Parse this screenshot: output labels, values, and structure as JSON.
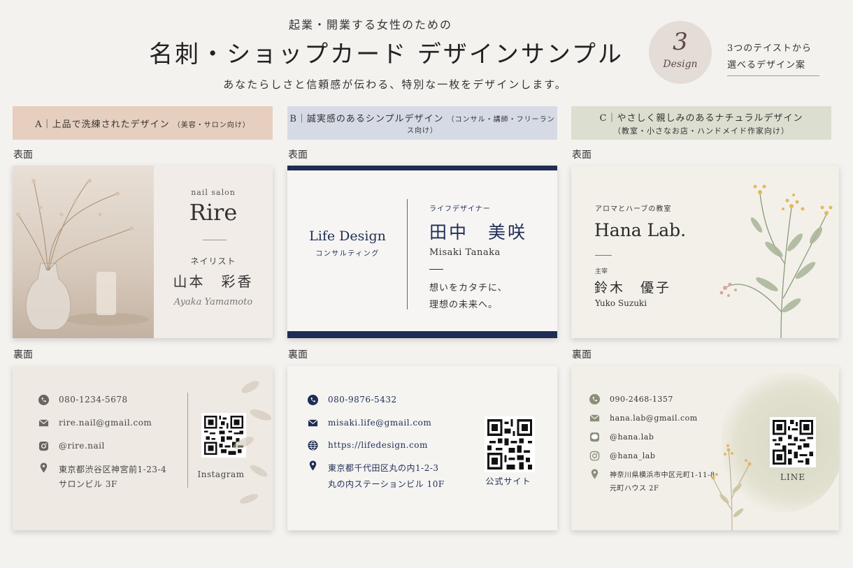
{
  "header": {
    "subtitle": "起業・開業する女性のための",
    "title": "名刺・ショップカード デザインサンプル",
    "tagline": "あなたらしさと信頼感が伝わる、特別な一枚をデザインします。",
    "badge_number": "3",
    "badge_word": "Design",
    "badge_note_line1": "3つのテイストから",
    "badge_note_line2": "選べるデザイン案"
  },
  "labels": {
    "front": "表面",
    "back": "裏面"
  },
  "columns": [
    {
      "id": "A",
      "title": "A｜上品で洗練されたデザイン",
      "note": "（美容・サロン向け）",
      "color": "#e6cfbf"
    },
    {
      "id": "B",
      "title": "B｜誠実感のあるシンプルデザイン",
      "note": "（コンサル・講師・フリーランス向け）",
      "color": "#d5dae5"
    },
    {
      "id": "C",
      "title": "C｜やさしく親しみのあるナチュラルデザイン",
      "note": "（教室・小さなお店・ハンドメイド作家向け）",
      "color": "#dcdfd0"
    }
  ],
  "card_a": {
    "front": {
      "category": "nail salon",
      "brand": "Rire",
      "role": "ネイリスト",
      "name": "山本　彩香",
      "script_name": "Ayaka Yamamoto"
    },
    "back": {
      "phone": "080-1234-5678",
      "email": "rire.nail@gmail.com",
      "sns": "@rire.nail",
      "address1": "東京都渋谷区神宮前1-23-4",
      "address2": "サロンビル 3F",
      "qr_label": "Instagram"
    }
  },
  "card_b": {
    "front": {
      "brand": "Life Design",
      "brand_sub": "コンサルティング",
      "role": "ライフデザイナー",
      "name": "田中　美咲",
      "name_en": "Misaki Tanaka",
      "message1": "想いをカタチに、",
      "message2": "理想の未来へ。"
    },
    "back": {
      "phone": "080-9876-5432",
      "email": "misaki.life@gmail.com",
      "web": "https://lifedesign.com",
      "address1": "東京都千代田区丸の内1-2-3",
      "address2": "丸の内ステーションビル 10F",
      "qr_label": "公式サイト"
    }
  },
  "card_c": {
    "front": {
      "category": "アロマとハーブの教室",
      "brand": "Hana Lab.",
      "role": "主宰",
      "name": "鈴木　優子",
      "name_en": "Yuko Suzuki"
    },
    "back": {
      "phone": "090-2468-1357",
      "email": "hana.lab@gmail.com",
      "line_id": "@hana.lab",
      "instagram": "@hana_lab",
      "address1": "神奈川県横浜市中区元町1-11-8",
      "address2": "元町ハウス 2F",
      "qr_label": "LINE"
    }
  },
  "colors": {
    "navy": "#1f2d55",
    "icon_a": "#6b6460",
    "icon_c": "#8a8f78"
  }
}
